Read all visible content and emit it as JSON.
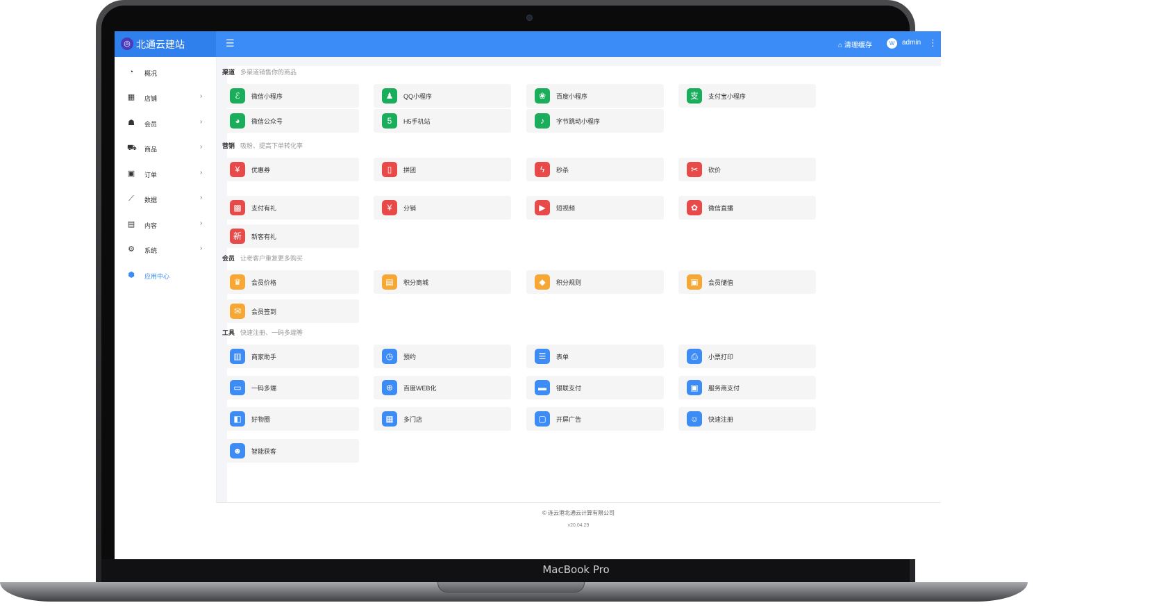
{
  "device": {
    "label": "MacBook Pro"
  },
  "header": {
    "logo_text": "北通云建站",
    "menu_icon": "☰",
    "clear_cache": "清理缓存",
    "avatar_letter": "W",
    "user": "admin",
    "more_icon": "⋮"
  },
  "sidebar": {
    "items": [
      {
        "label": "概况",
        "icon": "dashboard-icon",
        "glyph": "◔",
        "arrow": ""
      },
      {
        "label": "店铺",
        "icon": "grid-icon",
        "glyph": "▦",
        "arrow": "›"
      },
      {
        "label": "会员",
        "icon": "users-icon",
        "glyph": "☗",
        "arrow": "›"
      },
      {
        "label": "商品",
        "icon": "cart-icon",
        "glyph": "⛟",
        "arrow": "›"
      },
      {
        "label": "订单",
        "icon": "money-icon",
        "glyph": "▣",
        "arrow": "›"
      },
      {
        "label": "数据",
        "icon": "chart-icon",
        "glyph": "⟋",
        "arrow": "›"
      },
      {
        "label": "内容",
        "icon": "file-icon",
        "glyph": "▤",
        "arrow": "›"
      },
      {
        "label": "系统",
        "icon": "gear-icon",
        "glyph": "⚙",
        "arrow": "›"
      },
      {
        "label": "应用中心",
        "icon": "cube-icon",
        "glyph": "⬢",
        "arrow": ""
      }
    ]
  },
  "sections": [
    {
      "title": "渠道",
      "subtitle": "多渠道销售你的商品",
      "apps": [
        {
          "label": "微信小程序",
          "icon": "mini-program-icon",
          "glyph": "ℰ",
          "color": "#1aad5b"
        },
        {
          "label": "QQ小程序",
          "icon": "qq-icon",
          "glyph": "♟",
          "color": "#1aad5b"
        },
        {
          "label": "百度小程序",
          "icon": "baidu-paw-icon",
          "glyph": "❀",
          "color": "#1aad5b"
        },
        {
          "label": "支付宝小程序",
          "icon": "alipay-icon",
          "glyph": "支",
          "color": "#1aad5b"
        },
        {
          "label": "微信公众号",
          "icon": "wechat-icon",
          "glyph": "◕",
          "color": "#1aad5b"
        },
        {
          "label": "H5手机站",
          "icon": "html5-icon",
          "glyph": "5",
          "color": "#1aad5b"
        },
        {
          "label": "字节跳动小程序",
          "icon": "tiktok-icon",
          "glyph": "♪",
          "color": "#1aad5b"
        }
      ]
    },
    {
      "title": "营销",
      "subtitle": "吸粉、提高下单转化率",
      "apps": [
        {
          "label": "优惠券",
          "icon": "coupon-icon",
          "glyph": "¥",
          "color": "#e84a4a"
        },
        {
          "label": "拼团",
          "icon": "group-buy-icon",
          "glyph": "▯",
          "color": "#e84a4a"
        },
        {
          "label": "秒杀",
          "icon": "flash-icon",
          "glyph": "ϟ",
          "color": "#e84a4a"
        },
        {
          "label": "砍价",
          "icon": "bargain-icon",
          "glyph": "✂",
          "color": "#e84a4a"
        },
        {
          "label": "支付有礼",
          "icon": "gift-icon",
          "glyph": "▩",
          "color": "#e84a4a"
        },
        {
          "label": "分销",
          "icon": "moneybag-icon",
          "glyph": "¥",
          "color": "#e84a4a"
        },
        {
          "label": "短视频",
          "icon": "video-icon",
          "glyph": "▶",
          "color": "#e84a4a"
        },
        {
          "label": "微信直播",
          "icon": "live-icon",
          "glyph": "✿",
          "color": "#e84a4a"
        },
        {
          "label": "新客有礼",
          "icon": "new-customer-icon",
          "glyph": "新",
          "color": "#e84a4a"
        }
      ]
    },
    {
      "title": "会员",
      "subtitle": "让老客户重复更多购买",
      "apps": [
        {
          "label": "会员价格",
          "icon": "crown-icon",
          "glyph": "♛",
          "color": "#f7a733"
        },
        {
          "label": "积分商城",
          "icon": "points-mall-icon",
          "glyph": "▤",
          "color": "#f7a733"
        },
        {
          "label": "积分规则",
          "icon": "points-rule-icon",
          "glyph": "◆",
          "color": "#f7a733"
        },
        {
          "label": "会员储值",
          "icon": "wallet-icon",
          "glyph": "▣",
          "color": "#f7a733"
        },
        {
          "label": "会员签到",
          "icon": "checkin-icon",
          "glyph": "✉",
          "color": "#f7a733"
        }
      ]
    },
    {
      "title": "工具",
      "subtitle": "快速注册、一码多端等",
      "apps": [
        {
          "label": "商家助手",
          "icon": "store-assistant-icon",
          "glyph": "▥",
          "color": "#3d8cf5"
        },
        {
          "label": "预约",
          "icon": "clock-icon",
          "glyph": "◷",
          "color": "#3d8cf5"
        },
        {
          "label": "表单",
          "icon": "form-icon",
          "glyph": "☰",
          "color": "#3d8cf5"
        },
        {
          "label": "小票打印",
          "icon": "printer-icon",
          "glyph": "⎙",
          "color": "#3d8cf5"
        },
        {
          "label": "一码多端",
          "icon": "multi-device-icon",
          "glyph": "▭",
          "color": "#3d8cf5"
        },
        {
          "label": "百度WEB化",
          "icon": "globe-icon",
          "glyph": "⊕",
          "color": "#3d8cf5"
        },
        {
          "label": "银联支付",
          "icon": "unionpay-icon",
          "glyph": "▬",
          "color": "#3d8cf5"
        },
        {
          "label": "服务商支付",
          "icon": "provider-pay-icon",
          "glyph": "▣",
          "color": "#3d8cf5"
        },
        {
          "label": "好物圈",
          "icon": "good-items-icon",
          "glyph": "◧",
          "color": "#3d8cf5"
        },
        {
          "label": "多门店",
          "icon": "multi-store-icon",
          "glyph": "▦",
          "color": "#3d8cf5"
        },
        {
          "label": "开屏广告",
          "icon": "splash-ad-icon",
          "glyph": "▢",
          "color": "#3d8cf5"
        },
        {
          "label": "快速注册",
          "icon": "quick-register-icon",
          "glyph": "☺",
          "color": "#3d8cf5"
        },
        {
          "label": "智能获客",
          "icon": "smart-acquire-icon",
          "glyph": "☻",
          "color": "#3d8cf5"
        }
      ]
    }
  ],
  "footer": {
    "copyright": "© 连云港北通云计算有限公司",
    "version": "v20.04.29"
  }
}
